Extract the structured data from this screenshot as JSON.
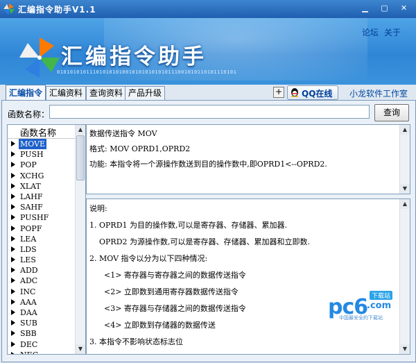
{
  "window": {
    "title": "汇编指令助手V1.1",
    "minimize": "▁",
    "maximize": "▢",
    "close": "✕"
  },
  "header": {
    "links": [
      "论坛",
      "关于"
    ],
    "logo_text": "汇编指令助手",
    "binary_text": "0101010101110101010100101010101010111001010110101110101"
  },
  "tabs": [
    {
      "label": "汇编指令",
      "active": true
    },
    {
      "label": "汇编资料",
      "active": false
    },
    {
      "label": "查询资料",
      "active": false
    },
    {
      "label": "产品升级",
      "active": false
    }
  ],
  "toolbar": {
    "plus": "+",
    "qq_label": "QQ在线",
    "studio": "小龙软件工作室"
  },
  "search": {
    "label": "函数名称：",
    "value": "",
    "button": "查询"
  },
  "list": {
    "header": "函数名称",
    "selected_index": 0,
    "items": [
      "MOVE",
      "PUSH",
      "POP",
      "XCHG",
      "XLAT",
      "LAHF",
      "SAHF",
      "PUSHF",
      "POPF",
      "LEA",
      "LDS",
      "LES",
      "ADD",
      "ADC",
      "INC",
      "AAA",
      "DAA",
      "SUB",
      "SBB",
      "DEC",
      "NEG"
    ]
  },
  "detail": {
    "lines": [
      "数据传送指令 MOV",
      "格式: MOV OPRD1,OPRD2",
      "功能: 本指令将一个源操作数送到目的操作数中,即OPRD1<--OPRD2."
    ]
  },
  "notes": {
    "lines": [
      "说明:",
      "1. OPRD1 为目的操作数,可以是寄存器、存储器、累加器.",
      "    OPRD2 为源操作数,可以是寄存器、存储器、累加器和立即数.",
      "2. MOV 指令以分为以下四种情况:",
      "      <1> 寄存器与寄存器之间的数据传送指令",
      "      <2> 立即数到通用寄存器数据传送指令",
      "      <3> 寄存器与存储器之间的数据传送指令",
      "      <4> 立即数到存储器的数据传送",
      "3. 本指令不影响状态标志位"
    ]
  },
  "watermark": {
    "brand": "pc6",
    "domain": ".com",
    "badge": "下载站",
    "slogan": "中国最安全的下载站"
  },
  "colors": {
    "title_bar": "#2a6fbe",
    "header_blue": "#3b93dc",
    "selection": "#1e60c9",
    "link": "#0047a0"
  }
}
